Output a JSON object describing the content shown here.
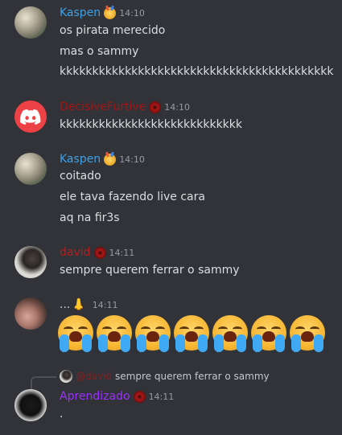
{
  "colors": {
    "kaspen": "#3ea0e6",
    "decisive": "#a31515",
    "david": "#b32020",
    "dots": "#d0d0d0",
    "aprendizado": "#9b30ff"
  },
  "messages": [
    {
      "author": "Kaspen",
      "time": "14:10",
      "lines": [
        "os pirata merecido",
        "mas o sammy",
        "kkkkkkkkkkkkkkkkkkkkkkkkkkkkkkkkkkkkkkkkkk"
      ]
    },
    {
      "author": "DecisiveFurtive",
      "time": "14:10",
      "lines": [
        "kkkkkkkkkkkkkkkkkkkkkkkkkkkk"
      ]
    },
    {
      "author": "Kaspen",
      "time": "14:10",
      "lines": [
        "coitado",
        "ele tava fazendo live cara",
        "aq na fir3s"
      ]
    },
    {
      "author": "david",
      "time": "14:11",
      "lines": [
        "sempre querem ferrar o sammy"
      ]
    },
    {
      "author": "...",
      "author_emoji": "👃",
      "time": "14:11",
      "emoji_count": 7,
      "emoji_name": "loudly-crying-face"
    },
    {
      "author": "Aprendizado",
      "time": "14:11",
      "lines": [
        "."
      ],
      "reply": {
        "author": "@david",
        "text": "sempre querem ferrar o sammy"
      }
    }
  ]
}
